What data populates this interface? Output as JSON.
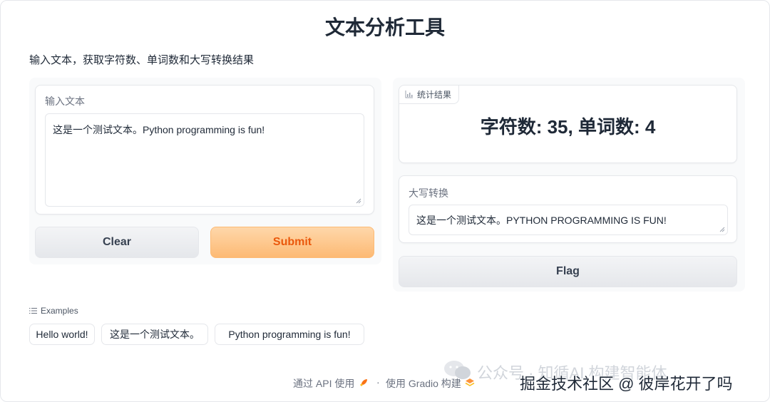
{
  "app": {
    "title": "文本分析工具",
    "description": "输入文本，获取字符数、单词数和大写转换结果"
  },
  "input": {
    "label": "输入文本",
    "value": "这是一个测试文本。Python programming is fun!"
  },
  "buttons": {
    "clear": "Clear",
    "submit": "Submit",
    "flag": "Flag"
  },
  "stats": {
    "tag_label": "统计结果",
    "result": "字符数: 35, 单词数: 4"
  },
  "uppercase": {
    "label": "大写转换",
    "value": "这是一个测试文本。PYTHON PROGRAMMING IS FUN!"
  },
  "examples": {
    "label": "Examples",
    "items": [
      "Hello world!",
      "这是一个测试文本。",
      "Python programming is fun!"
    ]
  },
  "footer": {
    "api_link": "通过 API 使用",
    "separator": "·",
    "built_with": "使用 Gradio 构建"
  },
  "watermark": {
    "line1": "公众号 · 知循AI 构建智能体",
    "line2": "掘金技术社区 @ 彼岸花开了吗"
  },
  "colors": {
    "primary": "#fdba74",
    "primary_text": "#ea580c"
  },
  "icons": {
    "chart": "bar-chart-icon",
    "list": "list-icon",
    "rocket": "rocket-icon",
    "gradio": "gradio-logo-icon",
    "wechat": "wechat-icon"
  }
}
